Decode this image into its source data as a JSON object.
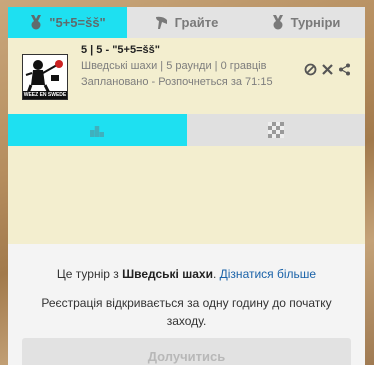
{
  "nav": {
    "tabs": [
      {
        "label": "\"5+5=šš\"",
        "icon": "medal-icon",
        "active": true
      },
      {
        "label": "Грайте",
        "icon": "horn-icon",
        "active": false
      },
      {
        "label": "Турніри",
        "icon": "medal-icon",
        "active": false
      }
    ]
  },
  "tournament": {
    "title": "5 | 5 - \"5+5=šš\"",
    "details": "Шведські шахи | 5 раунди | 0 гравців",
    "status": "Заплановано - Розпочнеться за 71:15",
    "logo_text": "WEEZ EN SWEDE"
  },
  "subtabs": [
    {
      "icon": "podium-icon",
      "active": true
    },
    {
      "icon": "chessboard-icon",
      "active": false
    }
  ],
  "info": {
    "prefix": "Це турнір з ",
    "variant": "Шведські шахи",
    "separator": ". ",
    "learn_more": "Дізнатися більше",
    "registration": "Реєстрація відкривається за одну годину до початку заходу."
  },
  "join_label": "Долучитись",
  "colors": {
    "accent": "#1ee0f1",
    "panel": "#f3eecf",
    "link": "#1a62a8"
  }
}
